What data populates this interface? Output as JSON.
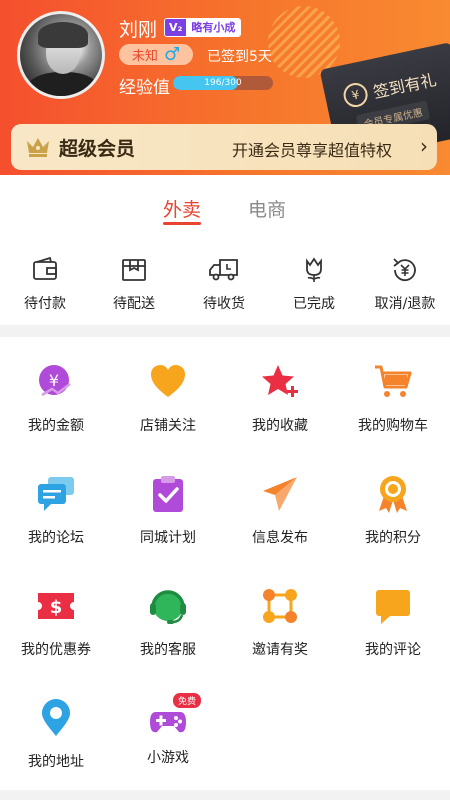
{
  "profile": {
    "username": "刘刚",
    "level_badge": "V₂",
    "level_text": "略有小成",
    "gender_text": "未知",
    "gender_icon": "♂",
    "signed_in": "已签到5天",
    "exp_label": "经验值",
    "exp_current": 196,
    "exp_max": 300,
    "exp_text": "196/300"
  },
  "sign_card": {
    "title": "签到有礼",
    "subtitle": "会员专属优惠",
    "icon": "¥"
  },
  "vip": {
    "title": "超级会员",
    "desc": "开通会员尊享超值特权",
    "arrow": "›"
  },
  "tabs": [
    {
      "label": "外卖",
      "active": true
    },
    {
      "label": "电商",
      "active": false
    }
  ],
  "orders": [
    {
      "label": "待付款",
      "icon": "wallet-icon"
    },
    {
      "label": "待配送",
      "icon": "package-icon"
    },
    {
      "label": "待收货",
      "icon": "truck-icon"
    },
    {
      "label": "已完成",
      "icon": "flower-icon"
    },
    {
      "label": "取消/退款",
      "icon": "refund-icon"
    }
  ],
  "grid": [
    {
      "label": "我的金额",
      "icon": "money-icon",
      "color": "#b04bd9"
    },
    {
      "label": "店铺关注",
      "icon": "heart-icon",
      "color": "#f7a51c"
    },
    {
      "label": "我的收藏",
      "icon": "star-icon",
      "color": "#ea2f44"
    },
    {
      "label": "我的购物车",
      "icon": "cart-icon",
      "color": "#f4832b"
    },
    {
      "label": "我的论坛",
      "icon": "chat-icon",
      "color": "#2ea3e3"
    },
    {
      "label": "同城计划",
      "icon": "clipboard-icon",
      "color": "#b04bd9"
    },
    {
      "label": "信息发布",
      "icon": "send-icon",
      "color": "#f4832b"
    },
    {
      "label": "我的积分",
      "icon": "medal-icon",
      "color": "#f7a51c"
    },
    {
      "label": "我的优惠券",
      "icon": "coupon-icon",
      "color": "#ea2f44"
    },
    {
      "label": "我的客服",
      "icon": "headset-icon",
      "color": "#2fb55a"
    },
    {
      "label": "邀请有奖",
      "icon": "network-icon",
      "color": "#f7a51c"
    },
    {
      "label": "我的评论",
      "icon": "comment-icon",
      "color": "#f7a51c"
    },
    {
      "label": "我的地址",
      "icon": "location-icon",
      "color": "#2ea3e3"
    },
    {
      "label": "小游戏",
      "icon": "gamepad-icon",
      "color": "#b04bd9",
      "badge": "免费"
    }
  ]
}
